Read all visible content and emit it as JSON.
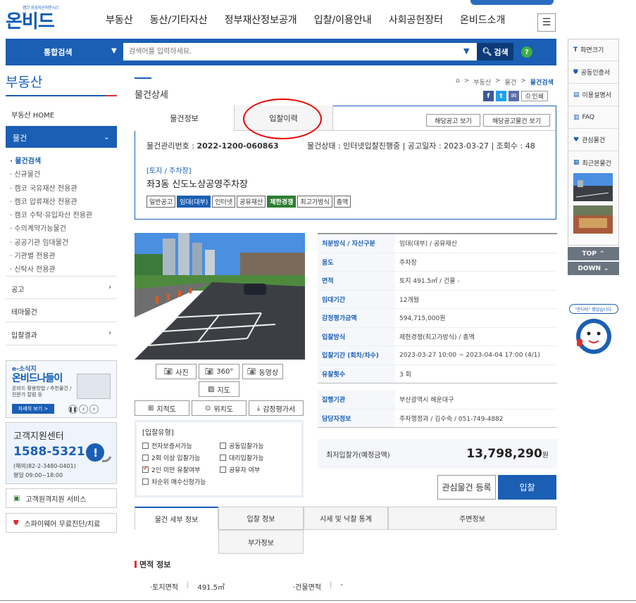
{
  "header": {
    "logo_sub": "캠코 공공자산처분시스템",
    "logo": "온비드",
    "nav": [
      "부동산",
      "동산/기타자산",
      "정부재산정보공개",
      "입찰/이용안내",
      "사회공헌장터",
      "온비드소개"
    ]
  },
  "search": {
    "scope": "통합검색",
    "placeholder": "검색어를 입력하세요.",
    "button": "검색",
    "help": "?"
  },
  "left_nav": {
    "title": "부동산",
    "home": "부동산 HOME",
    "active": "물건",
    "sub_items": [
      "물건검색",
      "신규물건",
      "캠코 국유재산 전용관",
      "캠코 압류재산 전용관",
      "캠코 수탁·유입자산 전용관",
      "수의계약가능물건",
      "공공기관 임대물건",
      "기관별 전용관",
      "신탁사 전용관"
    ],
    "items": [
      "공고",
      "테마물건",
      "입찰결과"
    ],
    "banner": {
      "tag": "e-소식지",
      "title": "온비드나들이",
      "desc1": "온비드 활용방법 / 추천물건 /",
      "desc2": "전문가 칼럼 등",
      "more": "자세히 보기 >"
    },
    "cs": {
      "title": "고객지원센터",
      "phone": "1588-5321",
      "overseas": "(해외)82-2-3480-0401)",
      "hours": "평일 09:00~18:00"
    },
    "services": [
      "고객원격지원 서비스",
      "스파이웨어 무료진단/치료"
    ]
  },
  "content": {
    "title": "물건상세",
    "breadcrumb": [
      "부동산",
      "물건",
      "물건검색"
    ],
    "print": "인쇄",
    "tabs": [
      "물건정보",
      "입찰이력"
    ],
    "small_buttons": [
      "해당공고 보기",
      "해당공고물건 보기"
    ],
    "meta": {
      "mgmt_label": "물건관리번호 : ",
      "mgmt_no": "2022-1200-060863",
      "status": "물건상태 : 인터넷입찰진행중",
      "notice_date": "공고일자 : 2023-03-27",
      "views": "조회수 : 48"
    },
    "category": "[토지 / 주차장]",
    "name": "좌3동 신도노상공영주차장",
    "badges": [
      "일반공고",
      "임대(대부)",
      "인터넷",
      "공유재산",
      "제한경쟁",
      "최고가방식",
      "총액"
    ],
    "image_buttons": [
      "사진",
      "360°",
      "동영상",
      "지도"
    ],
    "map_buttons": [
      "지적도",
      "위치도",
      "감정평가서"
    ],
    "bid_type": {
      "header": "[입찰유형]",
      "options": [
        {
          "label": "전자보증서가능",
          "checked": false
        },
        {
          "label": "공동입찰가능",
          "checked": false
        },
        {
          "label": "2회 이상 입찰가능",
          "checked": false
        },
        {
          "label": "대리입찰가능",
          "checked": false
        },
        {
          "label": "2인 미만 유찰여부",
          "checked": true
        },
        {
          "label": "공유자 여부",
          "checked": false
        },
        {
          "label": "차순위 매수신청가능",
          "checked": false
        }
      ]
    },
    "details": [
      {
        "k": "처분방식 / 자산구분",
        "v": "임대(대부) / 공유재산"
      },
      {
        "k": "용도",
        "v": "주차장"
      },
      {
        "k": "면적",
        "v": "토지 491.5㎡ / 건물 -"
      },
      {
        "k": "임대기간",
        "v": "12개월"
      },
      {
        "k": "감정평가금액",
        "v": "594,715,000원"
      },
      {
        "k": "입찰방식",
        "v": "제한경쟁(최고가방식) / 총액"
      },
      {
        "k": "입찰기간 (회차/차수)",
        "v": "2023-03-27 10:00 ~ 2023-04-04 17:00 (4/1)"
      },
      {
        "k": "유찰횟수",
        "v": "3 회"
      },
      {
        "k": "집행기관",
        "v": "부산광역시 해운대구"
      },
      {
        "k": "담당자정보",
        "v": "주차행정과 / 김수숙 / 051-749-4882"
      }
    ],
    "price_label": "최저입찰가(예정금액)",
    "price": "13,798,290",
    "price_unit": "원",
    "fav_button": "관심물건 등록",
    "bid_button": "입찰",
    "detail_tabs": [
      "물건 세부 정보",
      "입찰 정보",
      "시세 및 낙찰 통계",
      "주변정보",
      "부가정보"
    ],
    "area_section": "면적 정보",
    "land_area_label": "·토지면적",
    "land_area": "491.5㎡",
    "building_area_label": "·건물면적",
    "building_area": "-"
  },
  "right_side": {
    "items": [
      "화면크기",
      "공동인증서",
      "이용설명서",
      "FAQ",
      "관심물건",
      "최근본물건"
    ],
    "top": "TOP",
    "down": "DOWN",
    "mascot_text": "\"온디비\" 했었습니다."
  },
  "colors": {
    "brand": "#1a5fb4",
    "dark": "#0d3b78",
    "green": "#2e7d32",
    "red": "#e00000"
  }
}
